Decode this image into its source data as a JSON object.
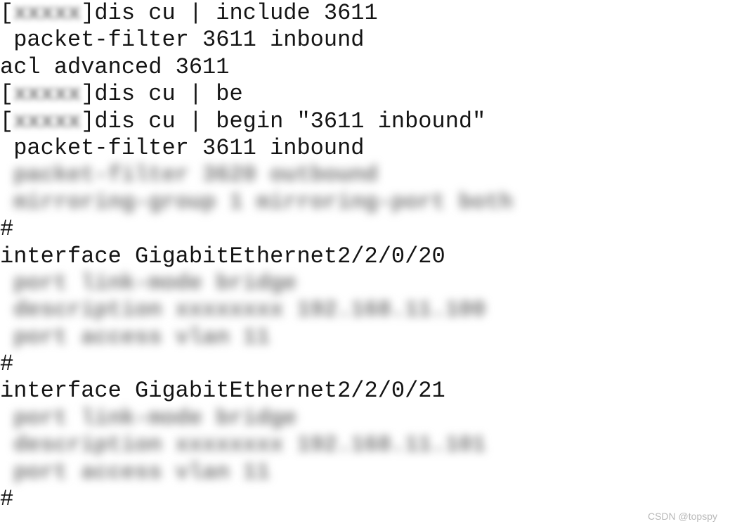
{
  "terminal": {
    "hostname_mask": "xxxxx",
    "lines": [
      "[xxxxx]dis cu | include 3611",
      " packet-filter 3611 inbound",
      "acl advanced 3611",
      "[xxxxx]dis cu | be",
      "[xxxxx]dis cu | begin \"3611 inbound\"",
      " packet-filter 3611 inbound",
      " packet-filter 3620 outbound",
      " mirroring-group 1 mirroring-port both",
      "#",
      "interface GigabitEthernet2/2/0/20",
      " port link-mode bridge",
      " description xxxxxxxx 192.168.11.100",
      " port access vlan 11",
      "#",
      "interface GigabitEthernet2/2/0/21",
      " port link-mode bridge",
      " description xxxxxxxx 192.168.11.101",
      " port access vlan 11",
      "#"
    ]
  },
  "watermark": "CSDN @topspy"
}
